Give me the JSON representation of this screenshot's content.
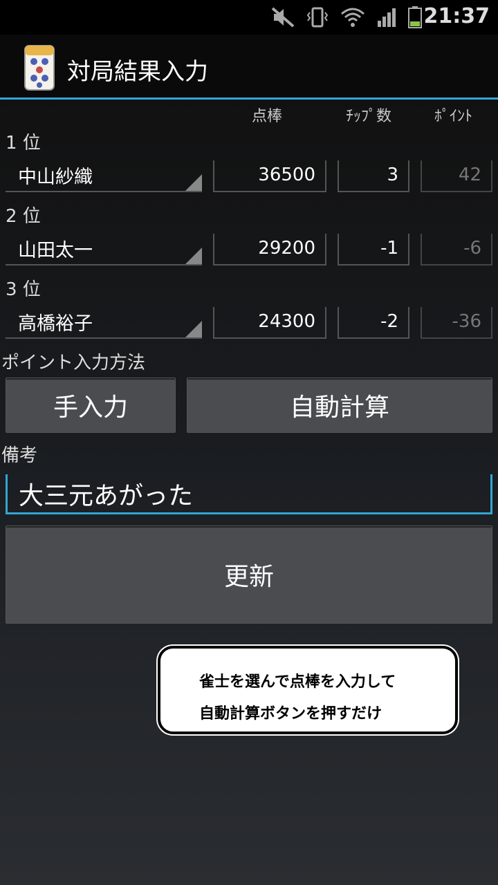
{
  "status_bar": {
    "time": "21:37",
    "icons": [
      "mute-icon",
      "vibrate-icon",
      "wifi-icon",
      "signal-icon",
      "battery-icon"
    ]
  },
  "app": {
    "title": "対局結果入力",
    "icon": "mahjong-tile-icon"
  },
  "columns": {
    "score": "点棒",
    "chips": "ﾁｯﾌﾟ数",
    "points": "ﾎﾟｲﾝﾄ"
  },
  "players": [
    {
      "rank": "1 位",
      "name": "中山紗織",
      "score": "36500",
      "chips": "3",
      "points": "42"
    },
    {
      "rank": "2 位",
      "name": "山田太一",
      "score": "29200",
      "chips": "-1",
      "points": "-6"
    },
    {
      "rank": "3 位",
      "name": "高橋裕子",
      "score": "24300",
      "chips": "-2",
      "points": "-36"
    }
  ],
  "point_method": {
    "label": "ポイント入力方法",
    "manual": "手入力",
    "auto": "自動計算"
  },
  "memo": {
    "label": "備考",
    "value": "大三元あがった"
  },
  "update_button": "更新",
  "tooltip": {
    "line1": "雀士を選んで点棒を入力して",
    "line2": "自動計算ボタンを押すだけ"
  },
  "colors": {
    "accent": "#33a6d6",
    "button": "#4a4c4f"
  }
}
